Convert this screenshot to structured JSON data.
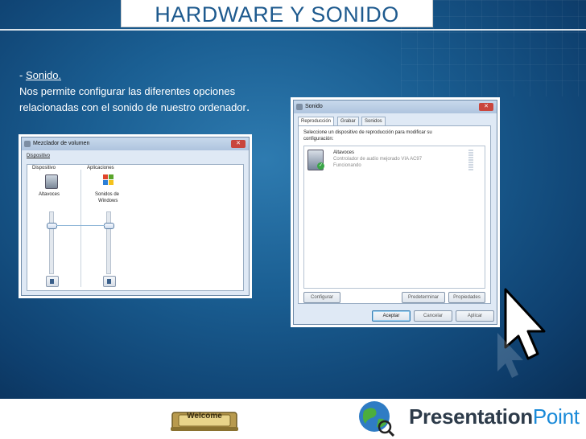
{
  "slide": {
    "title": "HARDWARE Y SONIDO",
    "bullet_prefix": "- ",
    "bullet_link": "Sonido.",
    "line1": "Nos permite configurar las diferentes opciones",
    "line2": "relacionadas con el sonido de nuestro ordenador",
    "line2_end": "."
  },
  "mixer": {
    "title": "Mezclador de volumen",
    "menu": "Dispositivo",
    "device_header": "Dispositivo",
    "apps_header": "Aplicaciones",
    "device_label": "Altavoces",
    "app_label_1": "Sonidos de",
    "app_label_2": "Windows",
    "device_level": 0.75,
    "app_level": 0.75
  },
  "sound": {
    "title": "Sonido",
    "tabs": [
      "Reproducción",
      "Grabar",
      "Sonidos"
    ],
    "prompt_1": "Seleccione un dispositivo de reproducción para modificar su",
    "prompt_2": "configuración:",
    "device_name": "Altavoces",
    "device_desc": "Controlador de audio mejorado VIA AC97",
    "device_status": "Funcionando",
    "btn_configure": "Configurar",
    "btn_default": "Predeterminar",
    "btn_properties": "Propiedades",
    "btn_accept": "Aceptar",
    "btn_cancel": "Cancelar",
    "btn_apply": "Aplicar"
  },
  "footer": {
    "welcome": "Welcome",
    "brand_bold": "Presentation",
    "brand_light": "Point"
  },
  "colors": {
    "background": "#1a5e92",
    "title": "#1e5a8e",
    "brand_accent": "#1a8ad8"
  }
}
